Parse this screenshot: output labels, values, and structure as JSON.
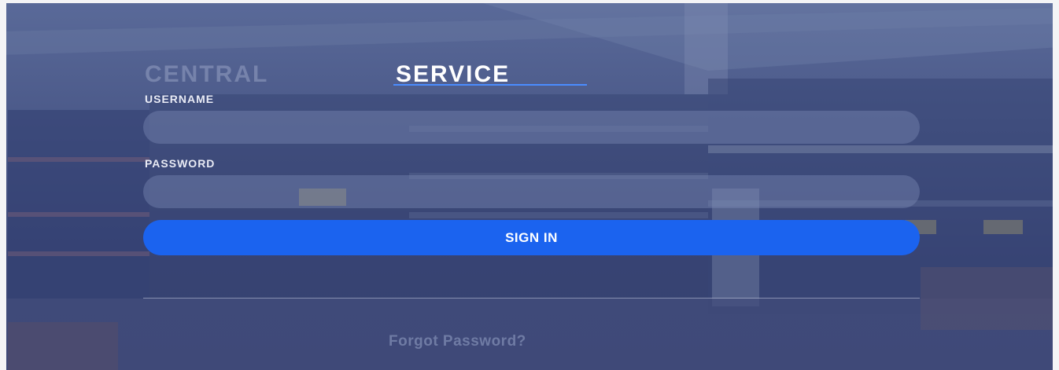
{
  "tabs": [
    {
      "label": "CENTRAL",
      "active": false
    },
    {
      "label": "SERVICE",
      "active": true
    }
  ],
  "form": {
    "username_label": "USERNAME",
    "username_value": "",
    "password_label": "PASSWORD",
    "password_value": "",
    "signin_label": "SIGN IN",
    "forgot_label": "Forgot Password?"
  },
  "colors": {
    "primary_button": "#1b63ef",
    "active_tab_underline": "#4a8cff",
    "overlay": "#3d4a78"
  }
}
